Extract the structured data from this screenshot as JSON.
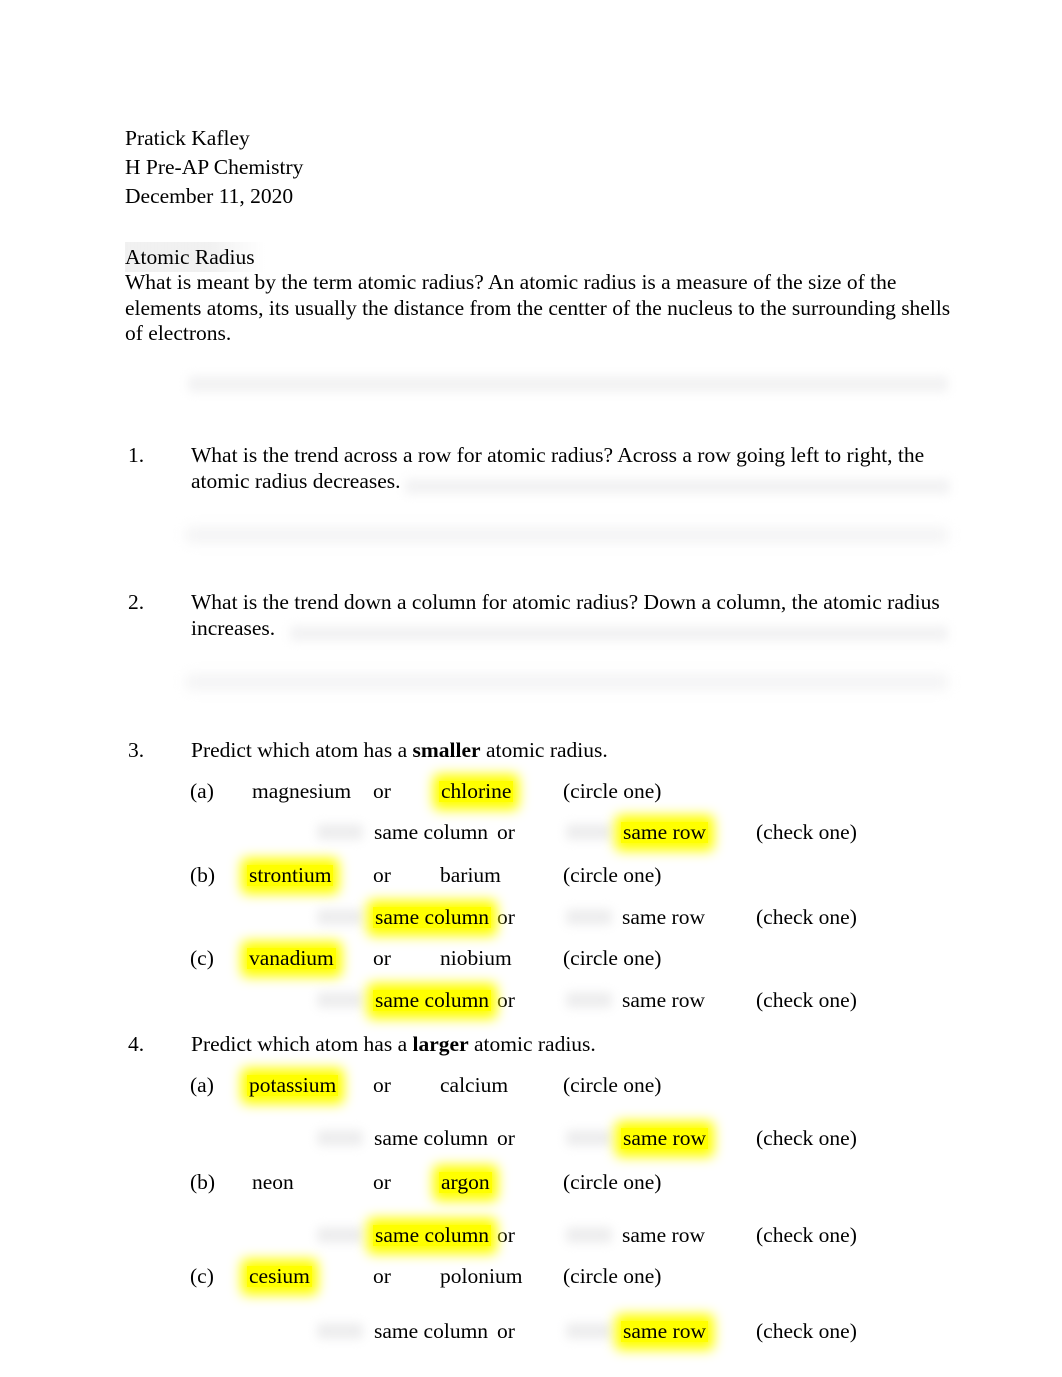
{
  "document": {
    "header": {
      "name": "Pratick Kafley",
      "course": "H Pre-AP Chemistry",
      "date": "December 11, 2020"
    },
    "section_title": "Atomic Radius",
    "intro_paragraph": "What is meant by the term atomic radius? An atomic radius is a measure of the size of the elements atoms, its usually the distance from the centter of the nucleus to the surrounding shells of electrons.",
    "questions": [
      {
        "number": "1.",
        "prompt": "What is the trend across a row for atomic radius? Across a row going left to right, the atomic radius decreases."
      },
      {
        "number": "2.",
        "prompt": "What is the trend down a column for atomic radius? Down a column, the atomic radius increases."
      },
      {
        "number": "3.",
        "prompt_before": "Predict which atom has a ",
        "prompt_bold": "smaller",
        "prompt_after": " atomic radius.",
        "items": [
          {
            "letter": "(a)",
            "option1": "magnesium",
            "option1_highlighted": false,
            "or": "or",
            "option2": "chlorine",
            "option2_highlighted": true,
            "circle_instruction": "(circle one)",
            "same_column": "same column",
            "same_column_highlighted": false,
            "row_or": "or",
            "same_row": "same row",
            "same_row_highlighted": true,
            "check_instruction": "(check one)"
          },
          {
            "letter": "(b)",
            "option1": "strontium",
            "option1_highlighted": true,
            "or": "or",
            "option2": "barium",
            "option2_highlighted": false,
            "circle_instruction": "(circle one)",
            "same_column": "same column",
            "same_column_highlighted": true,
            "row_or": "or",
            "same_row": "same row",
            "same_row_highlighted": false,
            "check_instruction": "(check one)"
          },
          {
            "letter": "(c)",
            "option1": "vanadium",
            "option1_highlighted": true,
            "or": "or",
            "option2": "niobium",
            "option2_highlighted": false,
            "circle_instruction": "(circle one)",
            "same_column": "same column",
            "same_column_highlighted": true,
            "row_or": "or",
            "same_row": "same row",
            "same_row_highlighted": false,
            "check_instruction": "(check one)"
          }
        ]
      },
      {
        "number": "4.",
        "prompt_before": "Predict which atom has a ",
        "prompt_bold": "larger",
        "prompt_after": " atomic radius.",
        "items": [
          {
            "letter": "(a)",
            "option1": "potassium",
            "option1_highlighted": true,
            "or": "or",
            "option2": "calcium",
            "option2_highlighted": false,
            "circle_instruction": "(circle one)",
            "same_column": "same column",
            "same_column_highlighted": false,
            "row_or": "or",
            "same_row": "same row",
            "same_row_highlighted": true,
            "check_instruction": "(check one)"
          },
          {
            "letter": "(b)",
            "option1": "neon",
            "option1_highlighted": false,
            "or": "or",
            "option2": "argon",
            "option2_highlighted": true,
            "circle_instruction": "(circle one)",
            "same_column": "same column",
            "same_column_highlighted": true,
            "row_or": "or",
            "same_row": "same row",
            "same_row_highlighted": false,
            "check_instruction": "(check one)"
          },
          {
            "letter": "(c)",
            "option1": "cesium",
            "option1_highlighted": true,
            "or": "or",
            "option2": "polonium",
            "option2_highlighted": false,
            "circle_instruction": "(circle one)",
            "same_column": "same column",
            "same_column_highlighted": false,
            "row_or": "or",
            "same_row": "same row",
            "same_row_highlighted": true,
            "check_instruction": "(check one)"
          }
        ]
      }
    ],
    "colors": {
      "highlight": "#ffff00",
      "text": "#000000",
      "page": "#ffffff",
      "smudge": "#f2f2f3"
    }
  }
}
